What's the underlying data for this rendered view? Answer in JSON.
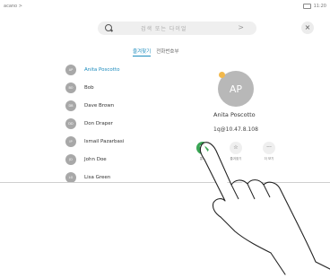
{
  "status": {
    "left": "acano >",
    "time": "11:20"
  },
  "search": {
    "placeholder": "검색 또는 다이얼",
    "chevron": ">"
  },
  "close": {
    "glyph": "×"
  },
  "tabs": [
    {
      "label": "즐겨찾기",
      "active": true
    },
    {
      "label": "전화번호부",
      "active": false
    }
  ],
  "contacts": [
    {
      "initials": "AP",
      "name": "Anita Poscotto",
      "selected": true
    },
    {
      "initials": "BO",
      "name": "Bob",
      "selected": false
    },
    {
      "initials": "DB",
      "name": "Dave Brown",
      "selected": false
    },
    {
      "initials": "DD",
      "name": "Don Draper",
      "selected": false
    },
    {
      "initials": "IP",
      "name": "Ismail Pazarbasi",
      "selected": false
    },
    {
      "initials": "JD",
      "name": "John Doe",
      "selected": false
    },
    {
      "initials": "LG",
      "name": "Lisa Green",
      "selected": false
    }
  ],
  "detail": {
    "initials": "AP",
    "name": "Anita Poscotto",
    "address": "1q@10.47.8.108",
    "actions": [
      {
        "glyph": "☎",
        "label": "통화",
        "kind": "call"
      },
      {
        "glyph": "☆",
        "label": "즐겨찾기",
        "kind": "favorite"
      },
      {
        "glyph": "···",
        "label": "더 보기",
        "kind": "more"
      }
    ]
  },
  "colors": {
    "accent": "#1b8bbd",
    "call": "#3aa655",
    "avatar": "#a8a8a8"
  }
}
